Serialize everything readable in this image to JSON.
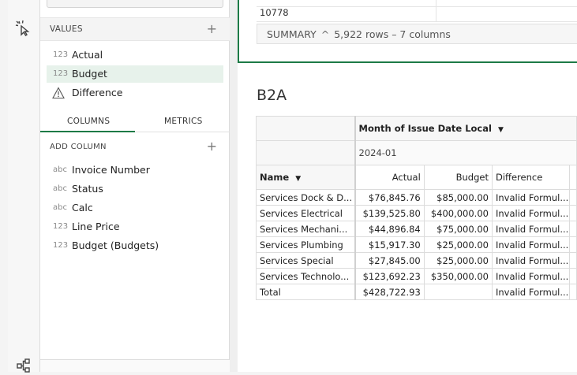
{
  "values_section": {
    "title": "VALUES",
    "items": [
      {
        "type": "123",
        "label": "Actual"
      },
      {
        "type": "123",
        "label": "Budget"
      },
      {
        "type": "warning",
        "label": "Difference"
      }
    ]
  },
  "tabs": {
    "columns": "COLUMNS",
    "metrics": "METRICS"
  },
  "add_column": {
    "title": "ADD COLUMN",
    "items": [
      {
        "type": "abc",
        "label": "Invoice Number"
      },
      {
        "type": "abc",
        "label": "Status"
      },
      {
        "type": "abc",
        "label": "Calc"
      },
      {
        "type": "123",
        "label": "Line Price"
      },
      {
        "type": "123",
        "label": "Budget (Budgets)"
      }
    ]
  },
  "top_table": {
    "last_value": "10778",
    "summary_label": "SUMMARY",
    "summary_caret": "^",
    "summary_stats": "5,922 rows – 7 columns"
  },
  "pivot": {
    "title": "B2A",
    "column_group": "Month of Issue Date Local",
    "period": "2024-01",
    "row_header": "Name",
    "headers": [
      "Actual",
      "Budget",
      "Difference"
    ],
    "rows": [
      {
        "name": "Services Dock & D...",
        "actual": "$76,845.76",
        "budget": "$85,000.00",
        "difference": "Invalid Formul..."
      },
      {
        "name": "Services Electrical",
        "actual": "$139,525.80",
        "budget": "$400,000.00",
        "difference": "Invalid Formul..."
      },
      {
        "name": "Services Mechani...",
        "actual": "$44,896.84",
        "budget": "$75,000.00",
        "difference": "Invalid Formul..."
      },
      {
        "name": "Services Plumbing",
        "actual": "$15,917.30",
        "budget": "$25,000.00",
        "difference": "Invalid Formul..."
      },
      {
        "name": "Services Special",
        "actual": "$27,845.00",
        "budget": "$25,000.00",
        "difference": "Invalid Formul..."
      },
      {
        "name": "Services Technolo...",
        "actual": "$123,692.23",
        "budget": "$350,000.00",
        "difference": "Invalid Formul..."
      }
    ],
    "total": {
      "name": "Total",
      "actual": "$428,722.93",
      "budget": "",
      "difference": "Invalid Formul..."
    }
  },
  "colors": {
    "accent": "#1d7a46",
    "selected_row": "#e7f2eb"
  }
}
